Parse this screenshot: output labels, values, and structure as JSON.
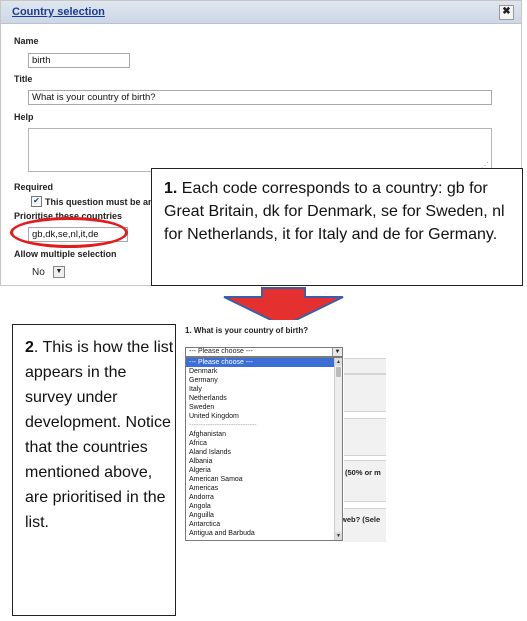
{
  "dialog": {
    "title": "Country selection",
    "close_glyph": "✖",
    "name_label": "Name",
    "name_value": "birth",
    "title_label": "Title",
    "title_value": "What is your country of birth?",
    "help_label": "Help",
    "help_value": "",
    "required_label": "Required",
    "required_checkbox_text": "This question must be an",
    "required_checked": true,
    "prioritise_label": "Prioritise these countries",
    "prioritise_value": "gb,dk,se,nl,it,de",
    "multiple_label": "Allow multiple selection",
    "multiple_value": "No"
  },
  "callout1": {
    "number": "1.",
    "text": "Each code corresponds to a country: gb for Great Britain,  dk for Denmark, se for Sweden, nl for Netherlands, it for Italy and de for Germany."
  },
  "callout2": {
    "number": "2",
    "text": ". This is how the list appears in the survey under development. Notice that the countries mentioned above, are prioritised in the list."
  },
  "highlight_color": "#e21b1b",
  "arrow": {
    "fill": "#e53030",
    "outline": "#3a5fa8"
  },
  "survey": {
    "question": "1. What is your country of birth?",
    "dropdown_value": "--- Please choose ---",
    "fragment_1": "(50% or m",
    "fragment_2": "web? (Sele",
    "options": [
      "--- Please choose ---",
      "Denmark",
      "Germany",
      "Italy",
      "Netherlands",
      "Sweden",
      "United Kingdom",
      "-----------------------------",
      "Afghanistan",
      "Africa",
      "Aland Islands",
      "Albania",
      "Algeria",
      "American Samoa",
      "Americas",
      "Andorra",
      "Angola",
      "Anguilla",
      "Antarctica",
      "Antigua and Barbuda"
    ]
  }
}
